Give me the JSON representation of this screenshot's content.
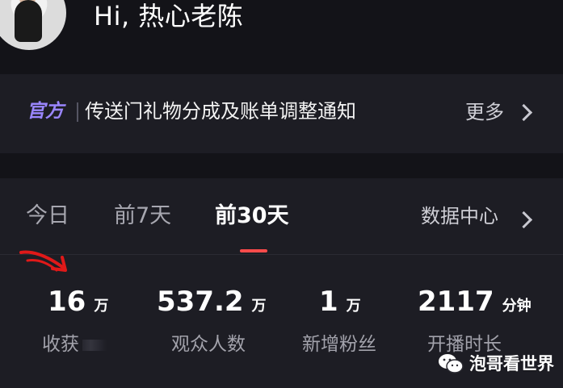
{
  "header": {
    "greeting": "Hi, 热心老陈"
  },
  "notice": {
    "tag": "官方",
    "text": "传送门礼物分成及账单调整通知",
    "more": "更多"
  },
  "tabs": [
    {
      "label": "今日",
      "active": false
    },
    {
      "label": "前7天",
      "active": false
    },
    {
      "label": "前30天",
      "active": true
    }
  ],
  "data_center_label": "数据中心",
  "stats": [
    {
      "value": "16",
      "unit": "万",
      "label": "收获"
    },
    {
      "value": "537.2",
      "unit": "万",
      "label": "观众人数"
    },
    {
      "value": "1",
      "unit": "万",
      "label": "新增粉丝"
    },
    {
      "value": "2117",
      "unit": "分钟",
      "label": "开播时长"
    }
  ],
  "watermark": {
    "text": "泡哥看世界",
    "icon": "wechat-icon"
  },
  "colors": {
    "background": "#131318",
    "panel": "#1d1d24",
    "accent": "#9a86ff",
    "indicator": "#ff4b4b"
  }
}
